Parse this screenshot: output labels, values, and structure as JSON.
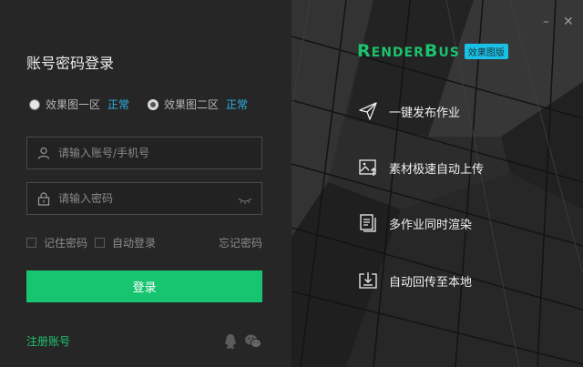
{
  "login": {
    "title": "账号密码登录",
    "servers": [
      {
        "label": "效果图一区",
        "status": "正常",
        "selected": false
      },
      {
        "label": "效果图二区",
        "status": "正常",
        "selected": true
      }
    ],
    "account_placeholder": "请输入账号/手机号",
    "password_placeholder": "请输入密码",
    "remember_label": "记住密码",
    "auto_login_label": "自动登录",
    "forgot_label": "忘记密码",
    "login_button": "登录",
    "register_link": "注册账号"
  },
  "brand": {
    "name_parts": [
      "R",
      "ENDER",
      "B",
      "US"
    ],
    "tag": "效果图版",
    "color": "#1cc36e",
    "tag_color": "#19c1e6"
  },
  "features": [
    {
      "label": "一键发布作业",
      "icon": "paper-plane-icon"
    },
    {
      "label": "素材极速自动上传",
      "icon": "image-upload-icon"
    },
    {
      "label": "多作业同时渲染",
      "icon": "multi-document-icon"
    },
    {
      "label": "自动回传至本地",
      "icon": "download-box-icon"
    }
  ],
  "window": {
    "minimize": "–",
    "close": "✕"
  },
  "colors": {
    "accent": "#17c470",
    "status": "#2fb0e8"
  }
}
